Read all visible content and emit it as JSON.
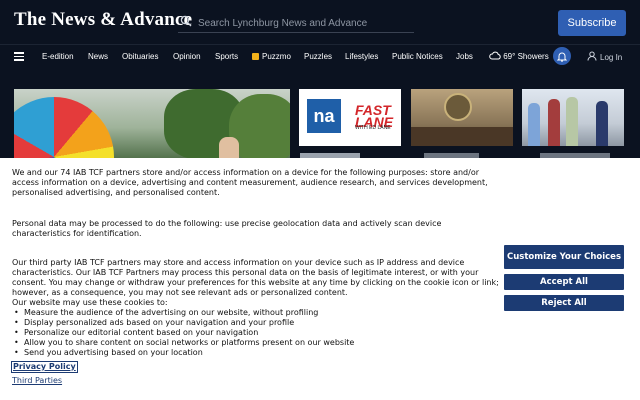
{
  "header": {
    "logo_text": "The News & Advance",
    "search": {
      "placeholder": "Search Lynchburg News and Advance",
      "icon": "search-icon"
    },
    "subscribe_label": "Subscribe"
  },
  "nav": {
    "items": [
      "E-edition",
      "News",
      "Obituaries",
      "Opinion",
      "Sports",
      "Puzzmo",
      "Puzzles",
      "Lifestyles",
      "Public Notices",
      "Jobs"
    ],
    "weather": {
      "temp": "69°",
      "condition": "Showers",
      "icon": "cloud-icon"
    },
    "login_label": "Log In"
  },
  "thumbnails": {
    "na_logo": "na",
    "fastlane_title": "FAST LANE",
    "fastlane_sub": "WITH ED LANE"
  },
  "consent": {
    "paragraph1": "We and our 74 IAB TCF partners store and/or access information on a device for the following purposes: store and/or access information on a device, advertising and content measurement, audience research, and services development, personalised advertising, and personalised content.",
    "paragraph2": "Personal data may be processed to do the following: use precise geolocation data and actively scan device characteristics for identification.",
    "paragraph3": "Our third party IAB TCF partners may store and access information on your device such as IP address and device characteristics. Our IAB TCF Partners may process this personal data on the basis of legitimate interest, or with your consent. You may change or withdraw your preferences for this website at any time by clicking on the cookie icon or link; however, as a consequence, you may not see relevant ads or personalized content.",
    "purposes_title": "Our website may use these cookies to:",
    "purposes": [
      "Measure the audience of the advertising on our website, without profiling",
      "Display personalized ads based on your navigation and your profile",
      "Personalize our editorial content based on your navigation",
      "Allow you to share content on social networks or platforms present on our website",
      "Send you advertising based on your location"
    ],
    "privacy_policy_label": "Privacy Policy",
    "third_parties_label": "Third Parties",
    "buttons": {
      "customize": "Customize Your Choices",
      "accept": "Accept All",
      "reject": "Reject All"
    },
    "colors": {
      "button_bg": "#1c3b73",
      "link": "#1c3b73"
    }
  },
  "colors": {
    "header_bg": "#0b1220",
    "accent": "#2f5fb3"
  }
}
